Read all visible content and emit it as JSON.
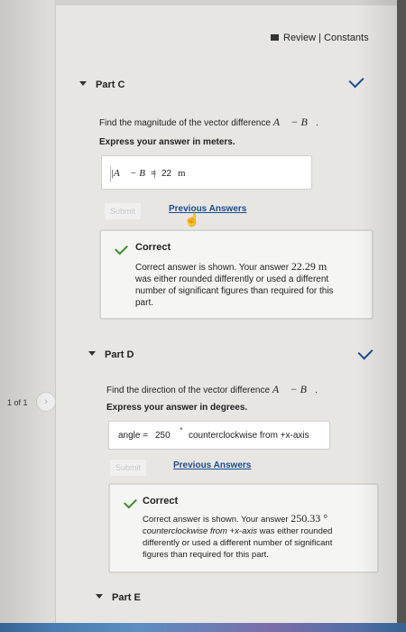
{
  "header": {
    "review_link": "Review | Constants"
  },
  "pager": {
    "label": "1 of 1",
    "next_glyph": "›"
  },
  "partC": {
    "title": "Part C",
    "question_prefix": "Find the magnitude of the vector difference ",
    "question_expr": "A⃗ − B⃗",
    "question_suffix": ".",
    "instruction": "Express your answer in meters.",
    "answer_lhs": "|A⃗ − B⃗|",
    "answer_eq": "=",
    "answer_value": "22",
    "answer_unit": "m",
    "submit_label": "Submit",
    "previous_answers": "Previous Answers",
    "feedback_title": "Correct",
    "feedback_line1": "Correct answer is shown. Your answer ",
    "feedback_value": "22.29 m",
    "feedback_line2": "was either rounded differently or used a different",
    "feedback_line3": "number of significant figures than required for this",
    "feedback_line4": "part."
  },
  "partD": {
    "title": "Part D",
    "question_prefix": "Find the direction of the vector difference ",
    "question_expr": "A⃗ − B⃗",
    "question_suffix": ".",
    "instruction": "Express your answer in degrees.",
    "answer_label": "angle =",
    "answer_value": "250",
    "answer_unit": "°",
    "answer_suffix": "counterclockwise from +x-axis",
    "submit_label": "Submit",
    "previous_answers": "Previous Answers",
    "feedback_title": "Correct",
    "feedback_line1": "Correct answer is shown. Your answer ",
    "feedback_value": "250.33 °",
    "feedback_line2a": "counterclockwise from +x-axis",
    "feedback_line2b": " was either rounded",
    "feedback_line3": "differently or used a different number of significant",
    "feedback_line4": "figures than required for this part."
  },
  "partE": {
    "title": "Part E"
  }
}
